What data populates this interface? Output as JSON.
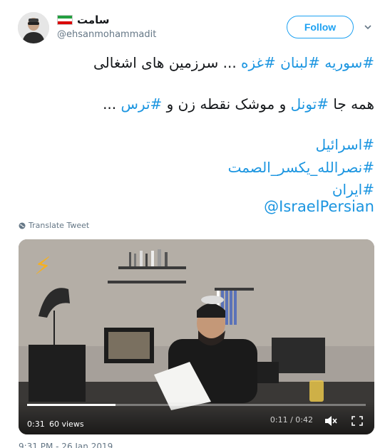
{
  "user": {
    "display_name": "سامت",
    "handle": "@ehsanmohammadit"
  },
  "follow_label": "Follow",
  "tweet": {
    "line1_tags": "#سوریه #لبنان #غزه",
    "line1_rest": " ... سرزمین های اشغالی",
    "line2_start": "همه جا ",
    "line2_tag1": "#تونل",
    "line2_mid": " و موشک نقطه زن و ",
    "line2_tag2": "#ترس",
    "line2_end": " ...",
    "line3": "#اسرائیل",
    "line4": "#نصرالله_یکسر_الصمت",
    "line5": "#ایران",
    "line6": "@IsraelPersian"
  },
  "translate_label": "Translate Tweet",
  "video": {
    "play_time": "0:31",
    "views": "60 views",
    "time_remaining": "0:11 / 0:42",
    "progress_fraction": 0.262
  },
  "footer": {
    "timestamp": "9:31 PM - 26 Jan 2019"
  },
  "colors": {
    "link": "#1b95e0",
    "follow_blue": "#1da1f2",
    "muted": "#657786"
  }
}
